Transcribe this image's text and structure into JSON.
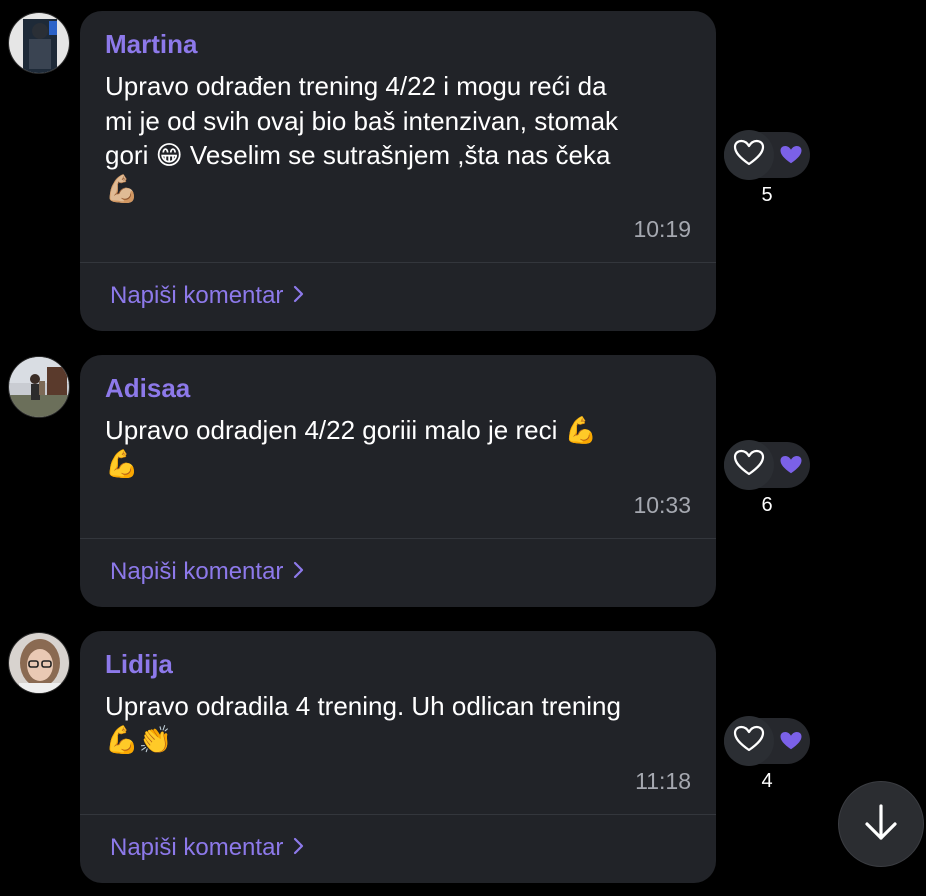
{
  "colors": {
    "background": "#000000",
    "bubble": "#212328",
    "accent": "#8d79ea",
    "timestamp": "#a5a8b0",
    "heart_badge": "#7b61e8"
  },
  "posts": [
    {
      "author": "Martina",
      "avatar_icon": "user-avatar-photo",
      "message_lines": [
        "Upravo odrađen trening 4/22 i mogu reći da",
        "mi je od svih ovaj bio baš intenzivan, stomak",
        "gori 😁  Veselim se sutrašnjem ,šta nas čeka",
        "💪🏼"
      ],
      "time": "10:19",
      "comment_label": "Napiši komentar",
      "reaction_count": "5"
    },
    {
      "author": "Adisaa",
      "avatar_icon": "user-avatar-photo",
      "message_lines": [
        "Upravo odradjen 4/22 goriii malo je reci 💪",
        "💪"
      ],
      "time": "10:33",
      "comment_label": "Napiši komentar",
      "reaction_count": "6"
    },
    {
      "author": "Lidija",
      "avatar_icon": "user-avatar-photo",
      "message_lines": [
        "Upravo odradila 4 trening. Uh odlican trening",
        "💪👏"
      ],
      "time": "11:18",
      "comment_label": "Napiši komentar",
      "reaction_count": "4"
    }
  ],
  "scroll_button_icon": "arrow-down-icon"
}
